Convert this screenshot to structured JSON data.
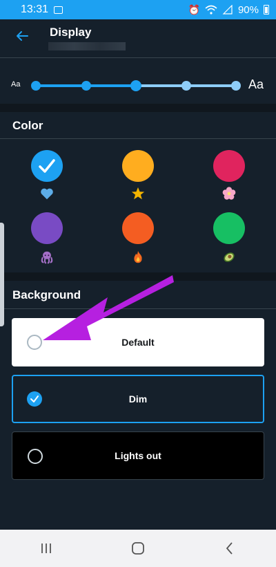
{
  "status_bar": {
    "time": "13:31",
    "battery": "90%"
  },
  "header": {
    "title": "Display"
  },
  "font_size": {
    "small_label": "Aa",
    "large_label": "Aa",
    "steps": 5,
    "selected_step": 3
  },
  "color_section": {
    "title": "Color",
    "options": [
      {
        "name": "blue",
        "color": "#1da1f2",
        "emoji": "heart-icon",
        "selected": true
      },
      {
        "name": "yellow",
        "color": "#ffad1f",
        "emoji": "star-icon",
        "selected": false
      },
      {
        "name": "pink",
        "color": "#e0245e",
        "emoji": "flower-icon",
        "selected": false
      },
      {
        "name": "purple",
        "color": "#794bc4",
        "emoji": "octopus-icon",
        "selected": false
      },
      {
        "name": "orange",
        "color": "#f45d22",
        "emoji": "fire-icon",
        "selected": false
      },
      {
        "name": "green",
        "color": "#17bf63",
        "emoji": "avocado-icon",
        "selected": false
      }
    ]
  },
  "background_section": {
    "title": "Background",
    "options": [
      {
        "label": "Default",
        "selected": false
      },
      {
        "label": "Dim",
        "selected": true
      },
      {
        "label": "Lights out",
        "selected": false
      }
    ]
  },
  "colors": {
    "accent": "#1da1f2",
    "dim_bg": "#15202b",
    "annotation_arrow": "#b620e0"
  }
}
